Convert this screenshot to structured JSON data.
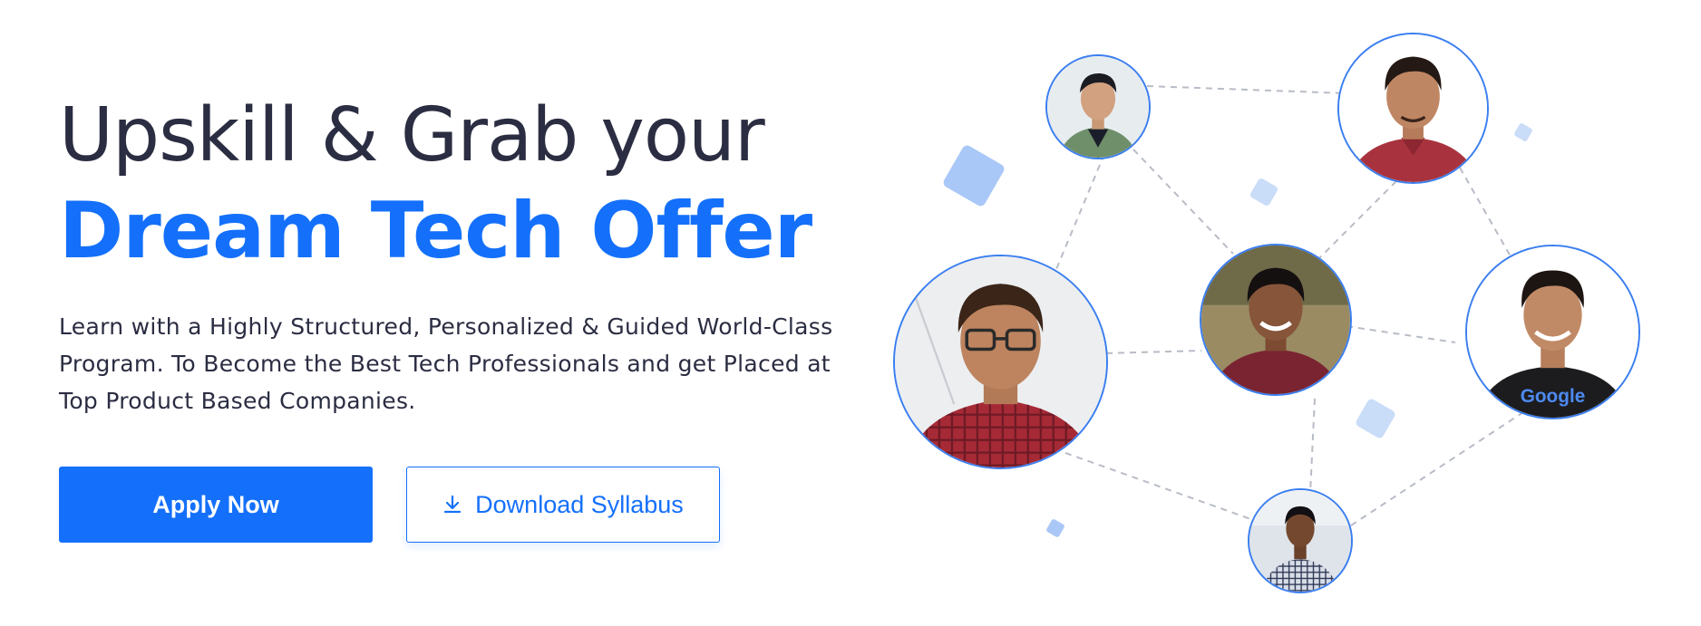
{
  "hero": {
    "headline_line1": "Upskill & Grab your",
    "headline_line2": "Dream Tech Offer",
    "description": "Learn with a Highly Structured, Personalized & Guided World-Class Program. To Become the Best Tech Professionals and get Placed at Top Product Based Companies.",
    "apply_button": "Apply Now",
    "download_button": "Download Syllabus",
    "download_icon": "download-icon"
  },
  "network": {
    "shirt_logo_text": "Google"
  },
  "colors": {
    "brand_blue": "#1470fa",
    "heading_dark": "#2b2d42",
    "node_border": "#3a7ef0",
    "deco_blue": "#a9c8f7"
  }
}
